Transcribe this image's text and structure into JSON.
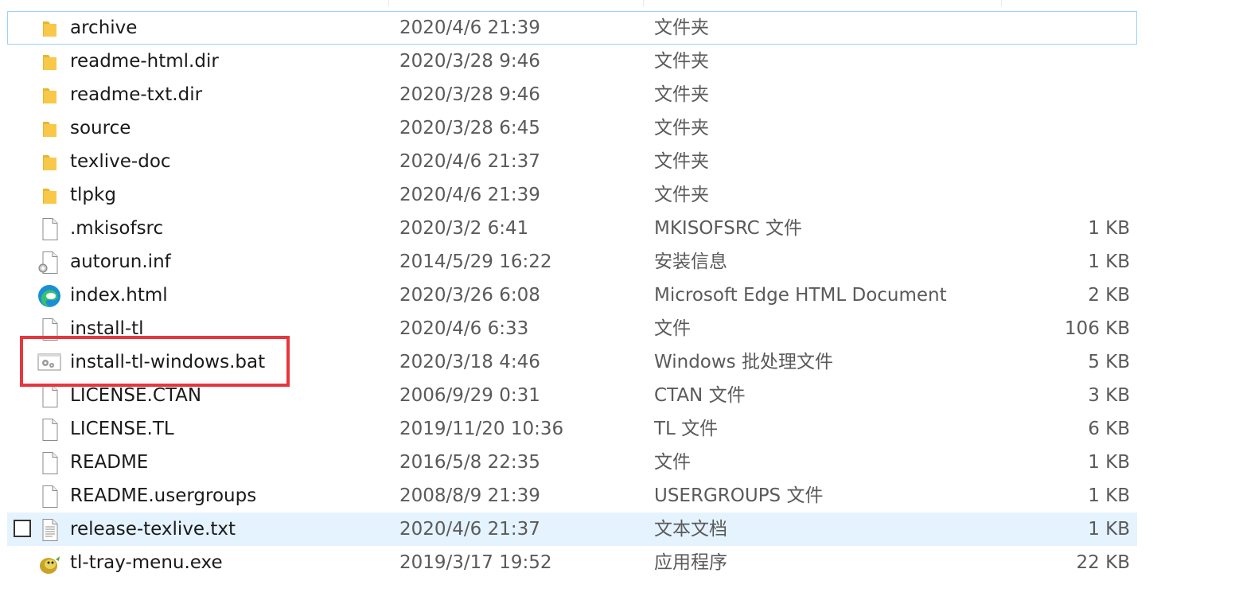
{
  "files": [
    {
      "name": "archive",
      "date": "2020/4/6 21:39",
      "type": "文件夹",
      "size": "",
      "icon": "folder-icon"
    },
    {
      "name": "readme-html.dir",
      "date": "2020/3/28 9:46",
      "type": "文件夹",
      "size": "",
      "icon": "folder-icon"
    },
    {
      "name": "readme-txt.dir",
      "date": "2020/3/28 9:46",
      "type": "文件夹",
      "size": "",
      "icon": "folder-icon"
    },
    {
      "name": "source",
      "date": "2020/3/28 6:45",
      "type": "文件夹",
      "size": "",
      "icon": "folder-icon"
    },
    {
      "name": "texlive-doc",
      "date": "2020/4/6 21:37",
      "type": "文件夹",
      "size": "",
      "icon": "folder-icon"
    },
    {
      "name": "tlpkg",
      "date": "2020/4/6 21:39",
      "type": "文件夹",
      "size": "",
      "icon": "folder-icon"
    },
    {
      "name": ".mkisofsrc",
      "date": "2020/3/2 6:41",
      "type": "MKISOFSRC 文件",
      "size": "1 KB",
      "icon": "blank-file-icon"
    },
    {
      "name": "autorun.inf",
      "date": "2014/5/29 16:22",
      "type": "安装信息",
      "size": "1 KB",
      "icon": "settings-file-icon"
    },
    {
      "name": "index.html",
      "date": "2020/3/26 6:08",
      "type": "Microsoft Edge HTML Document",
      "size": "2 KB",
      "icon": "edge-icon"
    },
    {
      "name": "install-tl",
      "date": "2020/4/6 6:33",
      "type": "文件",
      "size": "106 KB",
      "icon": "blank-file-icon"
    },
    {
      "name": "install-tl-windows.bat",
      "date": "2020/3/18 4:46",
      "type": "Windows 批处理文件",
      "size": "5 KB",
      "icon": "batch-file-icon"
    },
    {
      "name": "LICENSE.CTAN",
      "date": "2006/9/29 0:31",
      "type": "CTAN 文件",
      "size": "3 KB",
      "icon": "blank-file-icon"
    },
    {
      "name": "LICENSE.TL",
      "date": "2019/11/20 10:36",
      "type": "TL 文件",
      "size": "6 KB",
      "icon": "blank-file-icon"
    },
    {
      "name": "README",
      "date": "2016/5/8 22:35",
      "type": "文件",
      "size": "1 KB",
      "icon": "blank-file-icon"
    },
    {
      "name": "README.usergroups",
      "date": "2008/8/9 21:39",
      "type": "USERGROUPS 文件",
      "size": "1 KB",
      "icon": "blank-file-icon"
    },
    {
      "name": "release-texlive.txt",
      "date": "2020/4/6 21:37",
      "type": "文本文档",
      "size": "1 KB",
      "icon": "text-file-icon"
    },
    {
      "name": "tl-tray-menu.exe",
      "date": "2019/3/17 19:52",
      "type": "应用程序",
      "size": "22 KB",
      "icon": "app-lion-icon"
    }
  ],
  "colors": {
    "folder": "#f8c849",
    "highlight_box": "#e8363e",
    "hover_row": "#e5f3ff",
    "focus_border": "#99d1ff"
  }
}
